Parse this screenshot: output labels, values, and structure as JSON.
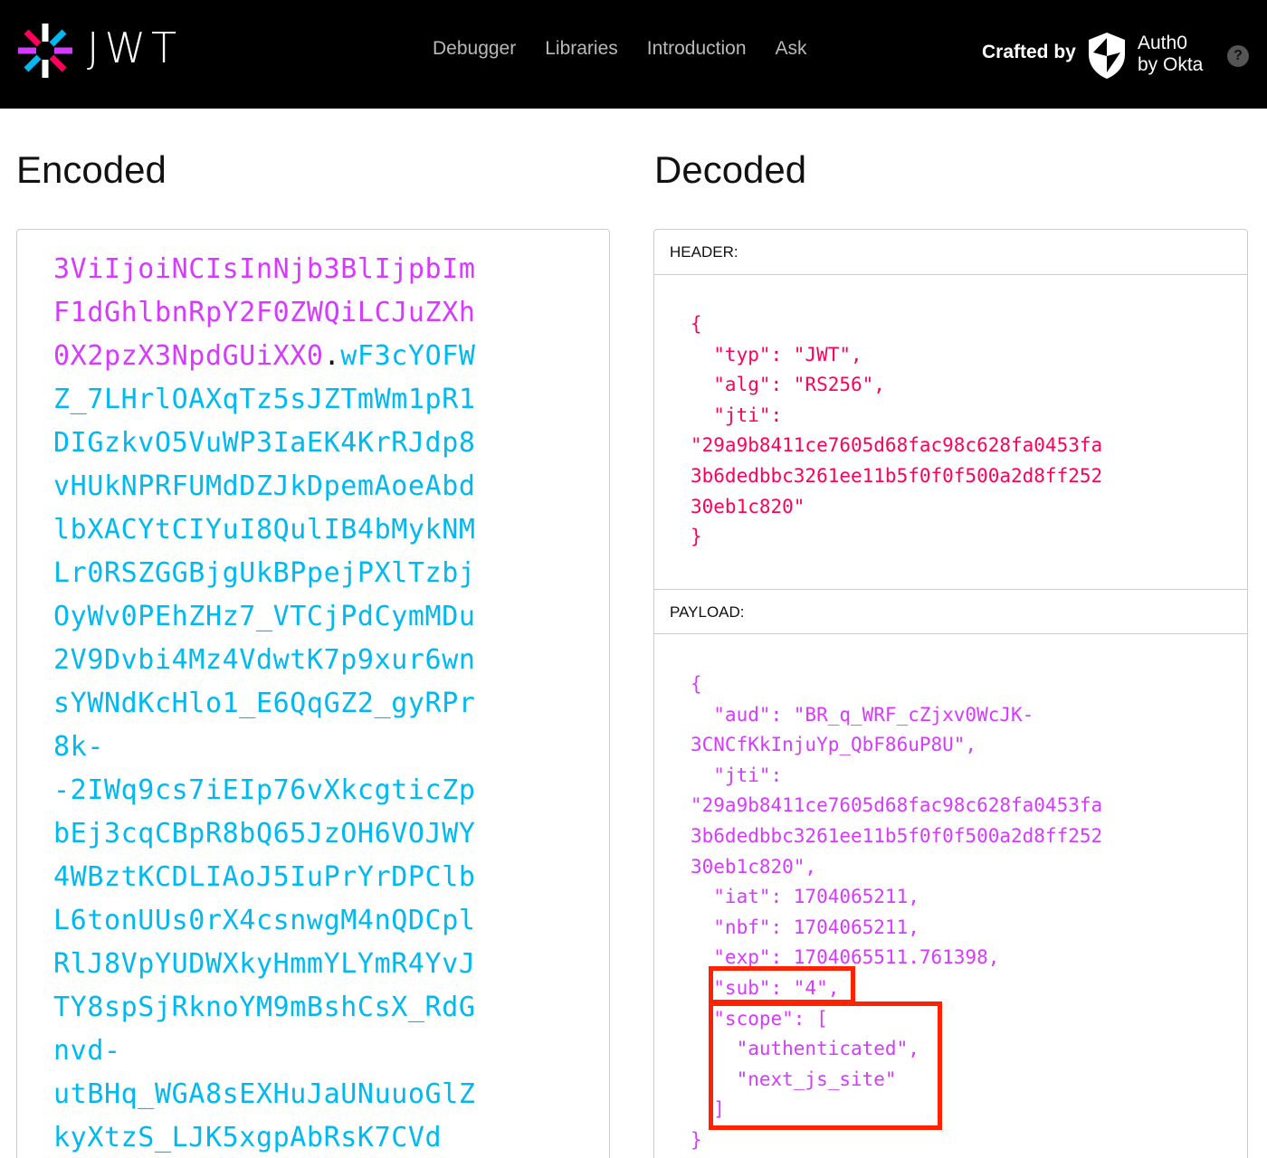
{
  "nav": {
    "logo_text": "JWT",
    "links": [
      "Debugger",
      "Libraries",
      "Introduction",
      "Ask"
    ],
    "crafted_by": "Crafted by",
    "auth0_line1": "Auth0",
    "auth0_line2": "by Okta",
    "help": "?"
  },
  "encoded": {
    "title": "Encoded",
    "payload_lines": [
      "3ViIjoiNCIsInNjb3BlIjpbIm",
      "F1dGhlbnRpY2F0ZWQiLCJuZXh",
      "0X2pzX3NpdGUiXX0"
    ],
    "dot": ".",
    "sig_first": "wF3cYOFW",
    "sig_lines": [
      "Z_7LHrlOAXqTz5sJZTmWm1pR1",
      "DIGzkvO5VuWP3IaEK4KrRJdp8",
      "vHUkNPRFUMdDZJkDpemAoeAbd",
      "lbXACYtCIYuI8QulIB4bMykNM",
      "Lr0RSZGGBjgUkBPpejPXlTzbj",
      "OyWv0PEhZHz7_VTCjPdCymMDu",
      "2V9Dvbi4Mz4VdwtK7p9xur6wn",
      "sYWNdKcHlo1_E6QqGZ2_gyRPr",
      "8k-",
      "-2IWq9cs7iEIp76vXkcgticZp",
      "bEj3cqCBpR8bQ65JzOH6VOJWY",
      "4WBztKCDLIAoJ5IuPrYrDPClb",
      "L6tonUUs0rX4csnwgM4nQDCpl",
      "RlJ8VpYUDWXkyHmmYLYmR4YvJ",
      "TY8spSjRknoYM9mBshCsX_RdG",
      "nvd-",
      "utBHq_WGA8sEXHuJaUNuuoGlZ",
      "kyXtzS_LJK5xgpAbRsK7CVd"
    ]
  },
  "decoded": {
    "title": "Decoded",
    "header_label": "HEADER:",
    "payload_label": "PAYLOAD:",
    "header_json": "{\n  \"typ\": \"JWT\",\n  \"alg\": \"RS256\",\n  \"jti\":\n\"29a9b8411ce7605d68fac98c628fa0453fa\n3b6dedbbc3261ee11b5f0f0f500a2d8ff252\n30eb1c820\"\n}",
    "payload_json": "{\n  \"aud\": \"BR_q_WRF_cZjxv0WcJK-\n3CNCfKkInjuYp_QbF86uP8U\",\n  \"jti\":\n\"29a9b8411ce7605d68fac98c628fa0453fa\n3b6dedbbc3261ee11b5f0f0f500a2d8ff252\n30eb1c820\",\n  \"iat\": 1704065211,\n  \"nbf\": 1704065211,\n  \"exp\": 1704065511.761398,\n  \"sub\": \"4\",\n  \"scope\": [\n    \"authenticated\",\n    \"next_js_site\"\n  ]\n}"
  },
  "colors": {
    "payload_purple": "#d63aff",
    "signature_blue": "#00b9f1",
    "header_red": "#fb015b",
    "highlight_red": "#ff2200"
  }
}
